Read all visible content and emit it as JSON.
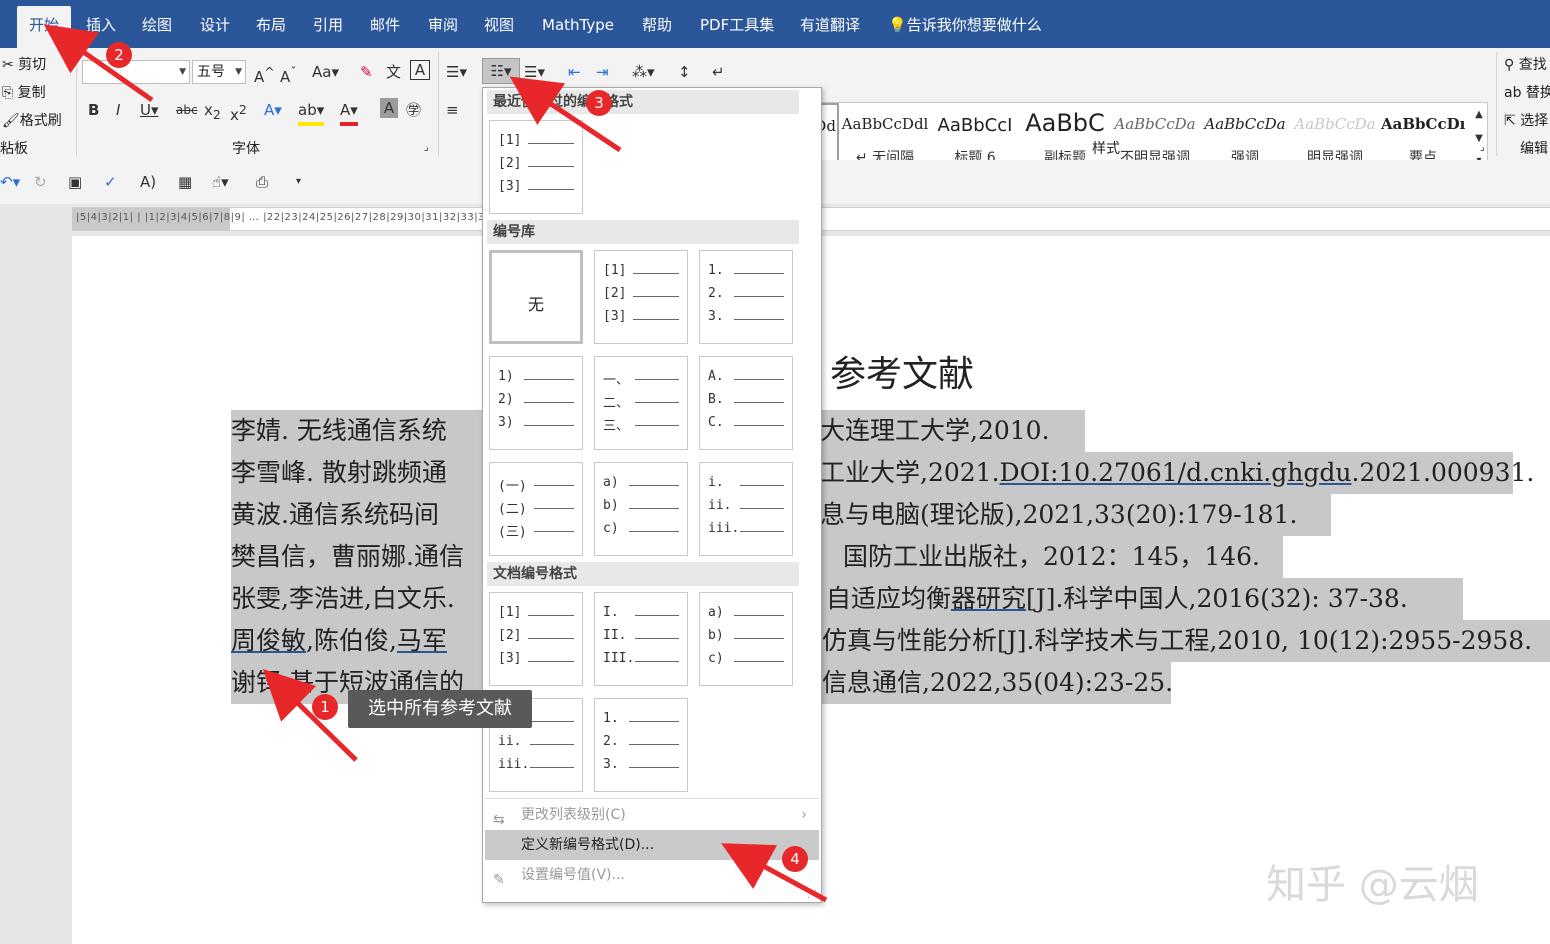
{
  "menu": {
    "tabs": [
      "开始",
      "插入",
      "绘图",
      "设计",
      "布局",
      "引用",
      "邮件",
      "审阅",
      "视图",
      "MathType",
      "帮助",
      "PDF工具集",
      "有道翻译"
    ],
    "tell_me": "告诉我你想要做什么"
  },
  "ribbon": {
    "clipboard": {
      "cut": "剪切",
      "copy": "复制",
      "format_painter": "格式刷",
      "group_label": "粘板"
    },
    "font": {
      "size": "五号",
      "group_label": "字体",
      "case_btn": "Aa"
    },
    "styles": {
      "group_label": "样式",
      "items": [
        {
          "sample": "AaBbCcDd",
          "name": ""
        },
        {
          "sample": "AaBbCcDdl",
          "name": "↵ 无间隔"
        },
        {
          "sample": "AaBbCcI",
          "name": "标题 6"
        },
        {
          "sample": "AaBbC",
          "name": "副标题"
        },
        {
          "sample": "AaBbCcDa",
          "name": "不明显强调"
        },
        {
          "sample": "AaBbCcDa",
          "name": "强调"
        },
        {
          "sample": "AaBbCcDa",
          "name": "明显强调"
        },
        {
          "sample": "AaBbCcDı",
          "name": "要点"
        }
      ]
    },
    "editing": {
      "find": "查找",
      "replace": "替换",
      "select": "选择",
      "group_label": "编辑"
    }
  },
  "ruler": {
    "numbers": "|5|4|3|2|1|  |  |1|2|3|4|5|6|7|8|9|  …  |22|23|24|25|26|27|28|29|30|31|32|33|34|35|36|37|38|39|40|41|42|43|44|45|46|"
  },
  "document": {
    "title": "参考文献",
    "lines": [
      {
        "left": "李婧. 无线通信系统",
        "right": "大连理工大学,2010."
      },
      {
        "left": "李雪峰. 散射跳频通",
        "right_pre": "工业大学,2021.",
        "right_link": "DOI:10.27061/d.cnki.ghgdu",
        "right_post": ".2021.000931."
      },
      {
        "left": "黄波.通信系统码间",
        "right": "息与电脑(理论版),2021,33(20):179-181."
      },
      {
        "left": "樊昌信，曹丽娜.通信",
        "right": "国防工业出版社，2012：145，146."
      },
      {
        "left": "张雯,李浩进,白文乐.",
        "right_pre": "自适应均衡",
        "right_link": "器研究",
        "right_post": "[J].科学中国人,2016(32): 37-38."
      },
      {
        "left_link": "周俊敏",
        "left_mid": ",陈伯俊,",
        "left_link2": "马军",
        "right": "仿真与性能分析[J].科学技术与工程,2010, 10(12):2955-2958."
      },
      {
        "left": "谢铎.基于短波通信的",
        "right": "信息通信,2022,35(04):23-25."
      }
    ]
  },
  "dropdown": {
    "recent_header": "最近使用过的编号格式",
    "library_header": "编号库",
    "doc_header": "文档编号格式",
    "none_label": "无",
    "recent": [
      [
        "[1]",
        "[2]",
        "[3]"
      ]
    ],
    "library": [
      [],
      [
        "[1]",
        "[2]",
        "[3]"
      ],
      [
        "1.",
        "2.",
        "3."
      ],
      [
        "1)",
        "2)",
        "3)"
      ],
      [
        "一、",
        "二、",
        "三、"
      ],
      [
        "A.",
        "B.",
        "C."
      ],
      [
        "(一)",
        "(二)",
        "(三)"
      ],
      [
        "a)",
        "b)",
        "c)"
      ],
      [
        "i.",
        "ii.",
        "iii."
      ]
    ],
    "doc_formats": [
      [
        "[1]",
        "[2]",
        "[3]"
      ],
      [
        "I.",
        "II.",
        "III."
      ],
      [
        "a)",
        "b)",
        "c)"
      ],
      [
        "i.",
        "ii.",
        "iii."
      ],
      [
        "1.",
        "2.",
        "3."
      ]
    ],
    "menu_items": [
      {
        "label": "更改列表级别(C)",
        "enabled": false
      },
      {
        "label": "定义新编号格式(D)...",
        "enabled": true
      },
      {
        "label": "设置编号值(V)...",
        "enabled": false
      }
    ]
  },
  "annotations": {
    "badges": [
      "1",
      "2",
      "3",
      "4"
    ],
    "tooltip": "选中所有参考文献",
    "arrow_color": "#e8272a"
  },
  "watermark": "知乎 @云烟",
  "colors": {
    "ribbon_blue": "#2b579a",
    "selection_gray": "#c8c8c8",
    "hover_gray": "#c9c9c9"
  }
}
